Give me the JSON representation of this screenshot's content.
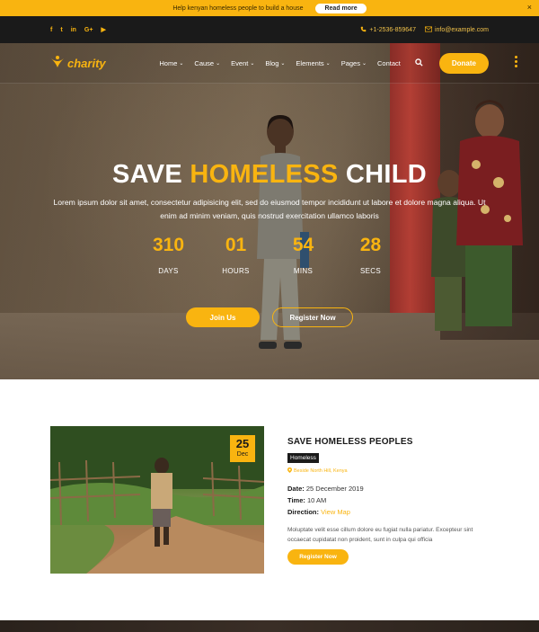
{
  "announcement": {
    "text": "Help kenyan homeless people to build a house",
    "button_label": "Read more",
    "close_symbol": "×"
  },
  "topbar": {
    "social_icons": [
      "facebook-icon",
      "twitter-icon",
      "linkedin-icon",
      "google-plus-icon",
      "youtube-icon"
    ],
    "social_glyphs": [
      "f",
      "t",
      "in",
      "G+",
      "▶"
    ],
    "phone": "+1-2536-859647",
    "email": "info@example.com"
  },
  "header": {
    "logo_text": "charity",
    "menu": [
      {
        "label": "Home",
        "dropdown": true
      },
      {
        "label": "Cause",
        "dropdown": true
      },
      {
        "label": "Event",
        "dropdown": true
      },
      {
        "label": "Blog",
        "dropdown": true
      },
      {
        "label": "Elements",
        "dropdown": true
      },
      {
        "label": "Pages",
        "dropdown": true
      },
      {
        "label": "Contact",
        "dropdown": false
      }
    ],
    "donate_label": "Donate"
  },
  "hero": {
    "title_part1": "SAVE",
    "title_highlight": "HOMELESS",
    "title_part2": "CHILD",
    "description": "Lorem ipsum dolor sit amet, consectetur adipisicing elit, sed do eiusmod tempor incididunt ut labore et dolore magna aliqua. Ut enim ad minim veniam, quis nostrud exercitation ullamco laboris",
    "countdown": [
      {
        "value": "310",
        "label": "DAYS"
      },
      {
        "value": "01",
        "label": "HOURS"
      },
      {
        "value": "54",
        "label": "MINS"
      },
      {
        "value": "28",
        "label": "SECS"
      }
    ],
    "join_label": "Join Us",
    "register_label": "Register Now"
  },
  "event": {
    "date_day": "25",
    "date_month": "Dec",
    "title": "SAVE HOMELESS PEOPLES",
    "tag": "Homeless",
    "location": "Beside North Hill, Kenya",
    "date_label": "Date:",
    "date_value": "25 December 2019",
    "time_label": "Time:",
    "time_value": "10 AM",
    "direction_label": "Direction:",
    "direction_link": "View Map",
    "description": "Moluptate velit esse cillum dolore eu fugiat nulla pariatur. Excepteur sint occaecat cupidatat non proident, sunt in culpa qui officia",
    "button_label": "Register Now"
  },
  "colors": {
    "accent": "#f9b410",
    "dark": "#1a1a1a"
  }
}
